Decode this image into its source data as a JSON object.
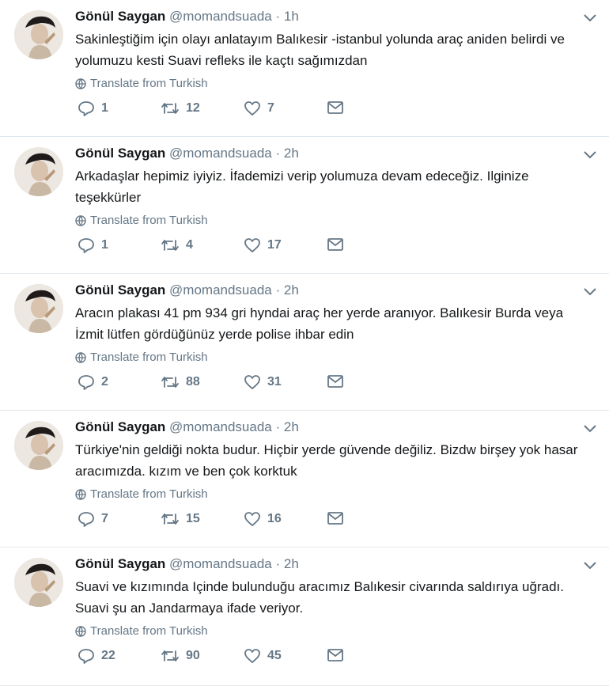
{
  "translate_label": "Translate from Turkish",
  "tweets": [
    {
      "name": "Gönül Saygan",
      "handle": "@momandsuada",
      "time": "1h",
      "text": "Sakinleştiğim için olayı anlatayım Balıkesir -istanbul yolunda araç aniden belirdi ve yolumuzu kesti Suavi refleks ile kaçtı sağımızdan",
      "replies": "1",
      "retweets": "12",
      "likes": "7"
    },
    {
      "name": "Gönül Saygan",
      "handle": "@momandsuada",
      "time": "2h",
      "text": "Arkadaşlar hepimiz iyiyiz. İfademizi verip yolumuza devam edeceğiz. Ilginize teşekkürler",
      "replies": "1",
      "retweets": "4",
      "likes": "17"
    },
    {
      "name": "Gönül Saygan",
      "handle": "@momandsuada",
      "time": "2h",
      "text": "Aracın plakası 41 pm 934 gri hyndai araç her yerde aranıyor. Balıkesir Burda veya İzmit lütfen gördüğünüz yerde polise ihbar edin",
      "replies": "2",
      "retweets": "88",
      "likes": "31"
    },
    {
      "name": "Gönül Saygan",
      "handle": "@momandsuada",
      "time": "2h",
      "text": "Türkiye'nin geldiği nokta budur. Hiçbir yerde güvende değiliz. Bizdw birşey yok hasar aracımızda. kızım ve ben çok korktuk",
      "replies": "7",
      "retweets": "15",
      "likes": "16"
    },
    {
      "name": "Gönül Saygan",
      "handle": "@momandsuada",
      "time": "2h",
      "text": "Suavi ve kızımında Içinde bulunduğu aracımız Balıkesir civarında saldırıya uğradı. Suavi şu an Jandarmaya ifade veriyor.",
      "replies": "22",
      "retweets": "90",
      "likes": "45"
    }
  ],
  "icons": {
    "reply": "reply-icon",
    "retweet": "retweet-icon",
    "like": "heart-icon",
    "dm": "envelope-icon",
    "translate": "globe-icon",
    "menu": "chevron-down-icon"
  },
  "colors": {
    "text": "#14171a",
    "muted": "#657786",
    "divider": "#e1e8ed"
  }
}
